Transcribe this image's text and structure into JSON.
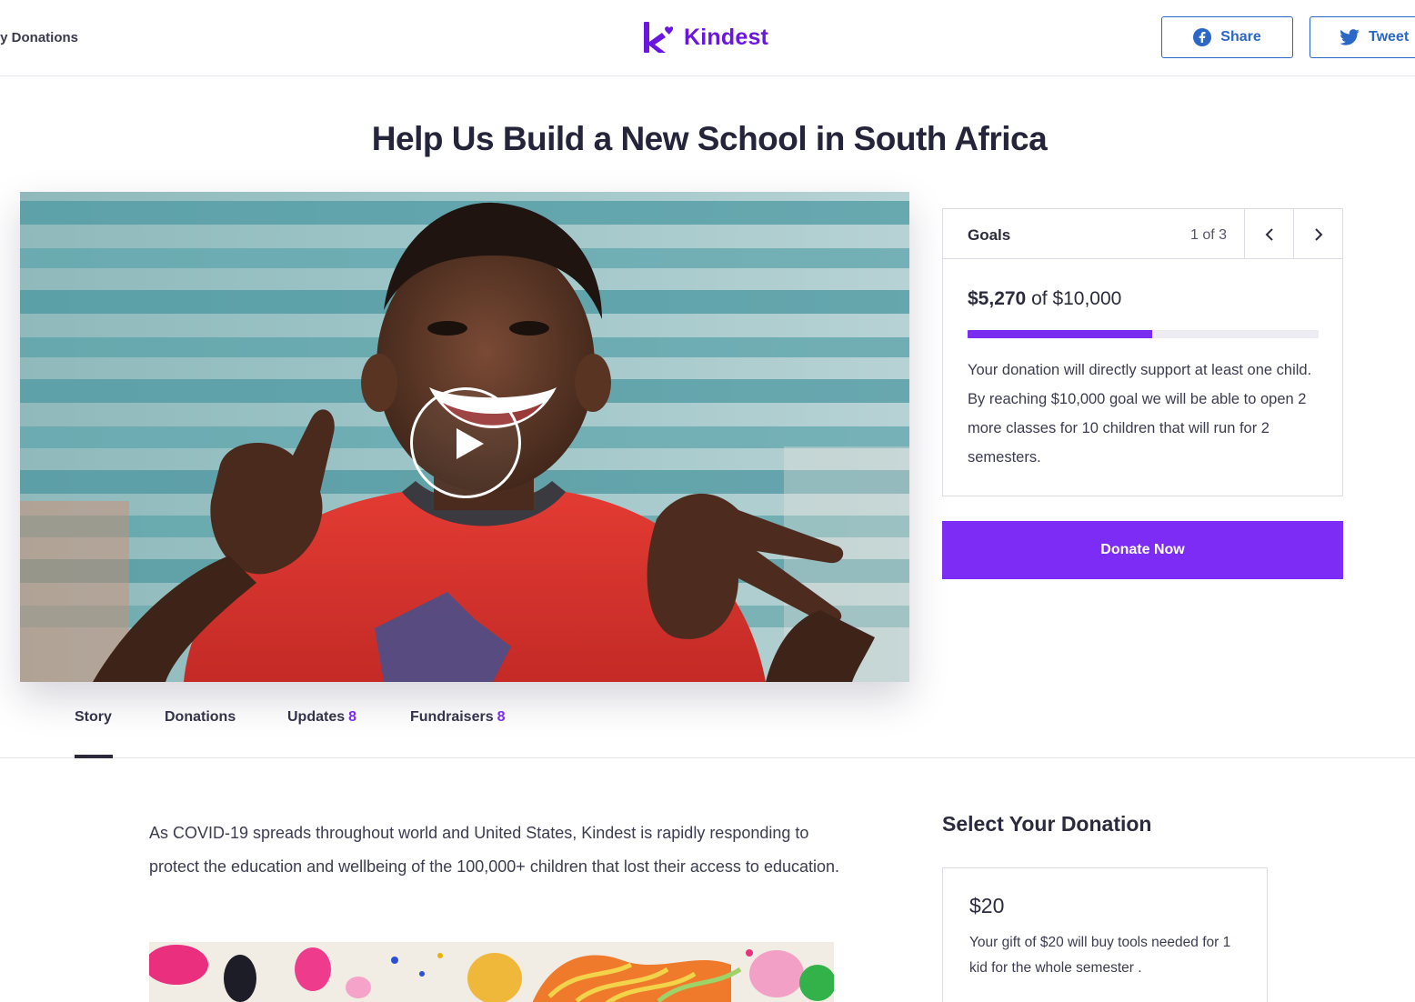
{
  "header": {
    "nav_link": "ly Donations",
    "logo_text": "Kindest",
    "share_facebook_label": "Share",
    "share_twitter_label": "Tweet"
  },
  "page_title": "Help Us Build a New School in South Africa",
  "goals": {
    "label": "Goals",
    "pager": "1 of 3",
    "raised": "$5,270",
    "of_word": "of",
    "target": "$10,000",
    "progress_fraction": 0.527,
    "description": "Your donation will directly support at least one child. By reaching $10,000 goal we will be able to open 2 more classes for 10 children that will run for 2 semesters."
  },
  "donate_button_label": "Donate Now",
  "tabs": [
    {
      "label": "Story",
      "count": "",
      "active": true
    },
    {
      "label": "Donations",
      "count": ""
    },
    {
      "label": "Updates",
      "count": "8"
    },
    {
      "label": "Fundraisers",
      "count": "8"
    }
  ],
  "story": {
    "paragraph": "As COVID-19 spreads throughout world and United States, Kindest is rapidly responding to protect the education and wellbeing of the 100,000+ children that lost their access to education."
  },
  "select_donation": {
    "title": "Select Your Donation",
    "options": [
      {
        "amount": "$20",
        "description": "Your gift of $20 will buy tools needed for 1 kid for the whole semester ."
      }
    ]
  },
  "colors": {
    "brand_purple": "#6a16e0",
    "button_purple": "#7d2cf6",
    "share_blue": "#2a67c6"
  },
  "icons": {
    "logo": "kindest-k-heart-icon",
    "facebook": "facebook-icon",
    "twitter": "twitter-icon",
    "play": "play-icon",
    "prev": "chevron-left-icon",
    "next": "chevron-right-icon"
  }
}
